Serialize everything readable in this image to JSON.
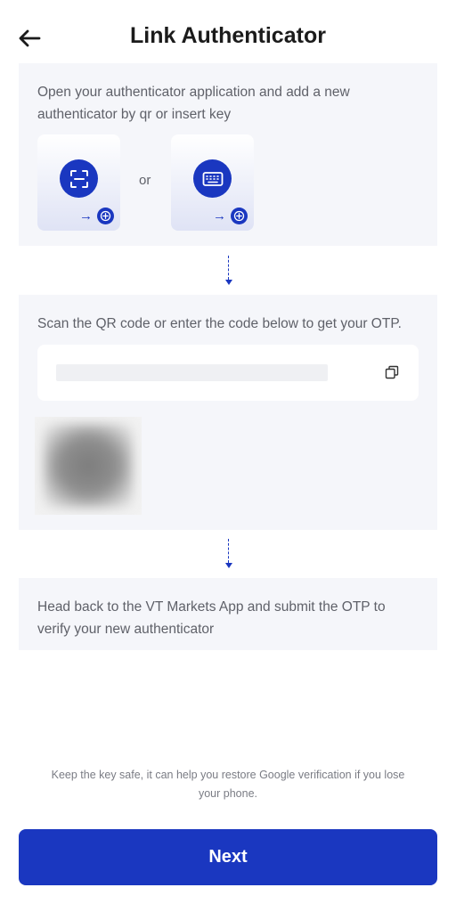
{
  "header": {
    "title": "Link Authenticator",
    "back_icon": "arrow-left-icon"
  },
  "step1": {
    "text": "Open your authenticator application and add a new authenticator by qr or insert key",
    "separator": "or",
    "options": [
      {
        "icon": "scan-qr-icon",
        "badge_icon": "add-circle-icon"
      },
      {
        "icon": "keyboard-icon",
        "badge_icon": "add-circle-icon"
      }
    ]
  },
  "step2": {
    "text": "Scan the QR code or enter the code below to get your OTP.",
    "copy_icon": "copy-icon"
  },
  "step3": {
    "text": "Head back to the VT Markets App and submit the OTP to verify your new authenticator"
  },
  "footer": {
    "note": "Keep the key safe, it can help you restore Google verification if you lose your phone."
  },
  "actions": {
    "next_label": "Next"
  },
  "colors": {
    "accent": "#1a37c0",
    "card_background": "#f5f6fa",
    "body_text": "#5f6169"
  }
}
